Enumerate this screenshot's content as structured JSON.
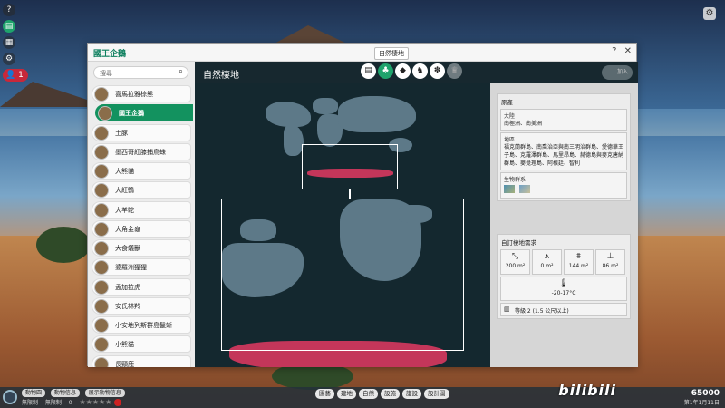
{
  "colors": {
    "accent": "#13925f",
    "habitat": "#c4365a",
    "map_bg": "#14282f",
    "land": "#5d7988"
  },
  "panel": {
    "species_title": "國王企鵝",
    "tab_tooltip": "自然棲地",
    "help_icon": "?",
    "close_icon": "✕"
  },
  "search": {
    "placeholder": "搜尋"
  },
  "species_list": [
    {
      "name": "喜馬拉雅棕熊",
      "selected": false
    },
    {
      "name": "國王企鵝",
      "selected": true
    },
    {
      "name": "土豚",
      "selected": false
    },
    {
      "name": "墨西哥紅膝捕鳥蛛",
      "selected": false
    },
    {
      "name": "大熊貓",
      "selected": false
    },
    {
      "name": "大紅鶴",
      "selected": false
    },
    {
      "name": "大羊駝",
      "selected": false
    },
    {
      "name": "大角金龜",
      "selected": false
    },
    {
      "name": "大食蟻獸",
      "selected": false
    },
    {
      "name": "婆羅洲猩猩",
      "selected": false
    },
    {
      "name": "孟加拉虎",
      "selected": false
    },
    {
      "name": "安氏林羚",
      "selected": false
    },
    {
      "name": "小安地列斯群島鬣蜥",
      "selected": false
    },
    {
      "name": "小熊貓",
      "selected": false
    },
    {
      "name": "長頸鹿",
      "selected": false
    }
  ],
  "section": {
    "title": "自然棲地",
    "tabs": [
      {
        "icon": "document-icon",
        "glyph": "▤",
        "active": false,
        "enabled": true
      },
      {
        "icon": "habitat-icon",
        "glyph": "♣",
        "active": true,
        "enabled": true
      },
      {
        "icon": "food-sack-icon",
        "glyph": "◆",
        "active": false,
        "enabled": true
      },
      {
        "icon": "animal-head-icon",
        "glyph": "♞",
        "active": false,
        "enabled": true
      },
      {
        "icon": "paw-icon",
        "glyph": "✽",
        "active": false,
        "enabled": true
      },
      {
        "icon": "trophy-icon",
        "glyph": "♛",
        "active": false,
        "enabled": false
      }
    ],
    "disabled_button_label": "加入"
  },
  "info": {
    "origin_title": "原產",
    "continent_label": "大陸",
    "continent_value": "南極洲、南美洲",
    "region_label": "地區",
    "region_value": "福克蘭群島、南喬治亞與南三明治群島、愛德華王子島、克羅澤群島、馬里昂島、赫德島與麥克唐納群島、麥覺理島、阿根廷、智利",
    "biome_label": "生物群系",
    "habitat_title": "自訂棲地需求",
    "requirements": [
      {
        "icon": "land-area-icon",
        "glyph": "⤡",
        "value": "200 m²"
      },
      {
        "icon": "climb-icon",
        "glyph": "⩚",
        "value": "0 m²"
      },
      {
        "icon": "grass-icon",
        "glyph": "⩩",
        "value": "144 m²"
      },
      {
        "icon": "water-icon",
        "glyph": "⊥",
        "value": "86 m²"
      }
    ],
    "temperature_icon": "🌡",
    "temperature": "-20-17°C",
    "fence_icon": "▥",
    "fence": "等級 2 (1.5 公尺以上)"
  },
  "bottom": {
    "pill_animals": "動物園",
    "pill_animal_info": "動物信息",
    "pill_exhibit": "展示動物信息",
    "stat_unlimited_1": "無限制",
    "stat_unlimited_2": "無限制",
    "guest_count": "0",
    "rating_stars": 0,
    "buttons": [
      "園藝",
      "建地",
      "自然",
      "設施",
      "護設",
      "設計圖"
    ],
    "money": "65000",
    "date": "第1年1月11日"
  },
  "watermark": "bilibili"
}
